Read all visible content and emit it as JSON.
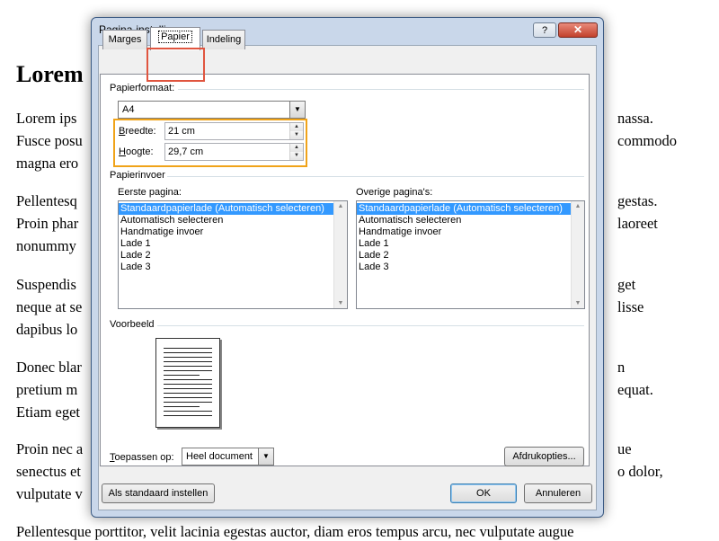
{
  "document": {
    "heading": "Lorem",
    "lines": [
      {
        "left": "Lorem ips",
        "right": "nassa."
      },
      {
        "left": "Fusce posu",
        "right": "commodo"
      },
      {
        "left": "magna ero",
        "right": ""
      },
      {
        "left": "Pellentesq",
        "right": "gestas."
      },
      {
        "left": "Proin phar",
        "right": "laoreet"
      },
      {
        "left": "nonummy",
        "right": ""
      },
      {
        "left": "Suspendis",
        "right": "get"
      },
      {
        "left": "neque at se",
        "right": "lisse"
      },
      {
        "left": "dapibus lo",
        "right": ""
      },
      {
        "left": "Donec blar",
        "right": "n"
      },
      {
        "left": "pretium m",
        "right": "equat."
      },
      {
        "left": "Etiam eget",
        "right": ""
      },
      {
        "left": "Proin nec a",
        "right": "ue"
      },
      {
        "left": "senectus et",
        "right": "o dolor,"
      },
      {
        "left": "vulputate v",
        "right": ""
      }
    ],
    "bottom_line": "Pellentesque porttitor, velit lacinia egestas auctor, diam eros tempus arcu, nec vulputate augue"
  },
  "dialog": {
    "title": "Pagina-instelling",
    "help_label": "?",
    "close_label": "✕",
    "tabs": [
      {
        "label": "Marges",
        "active": false
      },
      {
        "label": "Papier",
        "active": true
      },
      {
        "label": "Indeling",
        "active": false
      }
    ],
    "paper": {
      "format_section": "Papierformaat:",
      "format_value": "A4",
      "width_label_prefix": "B",
      "width_label_rest": "reedte:",
      "width_value": "21 cm",
      "height_label_prefix": "H",
      "height_label_rest": "oogte:",
      "height_value": "29,7 cm"
    },
    "source": {
      "section": "Papierinvoer",
      "first_page_label": "Eerste pagina:",
      "other_pages_label": "Overige pagina's:",
      "first_page_items": [
        {
          "label": "Standaardpapierlade (Automatisch selecteren)",
          "selected": true
        },
        {
          "label": "Automatisch selecteren",
          "selected": false
        },
        {
          "label": "Handmatige invoer",
          "selected": false
        },
        {
          "label": "Lade 1",
          "selected": false
        },
        {
          "label": "Lade 2",
          "selected": false
        },
        {
          "label": "Lade 3",
          "selected": false
        }
      ],
      "other_pages_items": [
        {
          "label": "Standaardpapierlade (Automatisch selecteren)",
          "selected": true
        },
        {
          "label": "Automatisch selecteren",
          "selected": false
        },
        {
          "label": "Handmatige invoer",
          "selected": false
        },
        {
          "label": "Lade 1",
          "selected": false
        },
        {
          "label": "Lade 2",
          "selected": false
        },
        {
          "label": "Lade 3",
          "selected": false
        }
      ]
    },
    "preview": {
      "section": "Voorbeeld"
    },
    "apply_to": {
      "label_prefix": "T",
      "label_rest": "oepassen op:",
      "value": "Heel document"
    },
    "print_options_button": "Afdrukopties...",
    "default_button": "Als standaard instellen",
    "ok_button": "OK",
    "cancel_button": "Annuleren"
  },
  "colors": {
    "highlight_tab": "#e0553f",
    "highlight_size": "#f0a319",
    "selection": "#3399ff",
    "dialog_frame": "#c9d7ea"
  }
}
